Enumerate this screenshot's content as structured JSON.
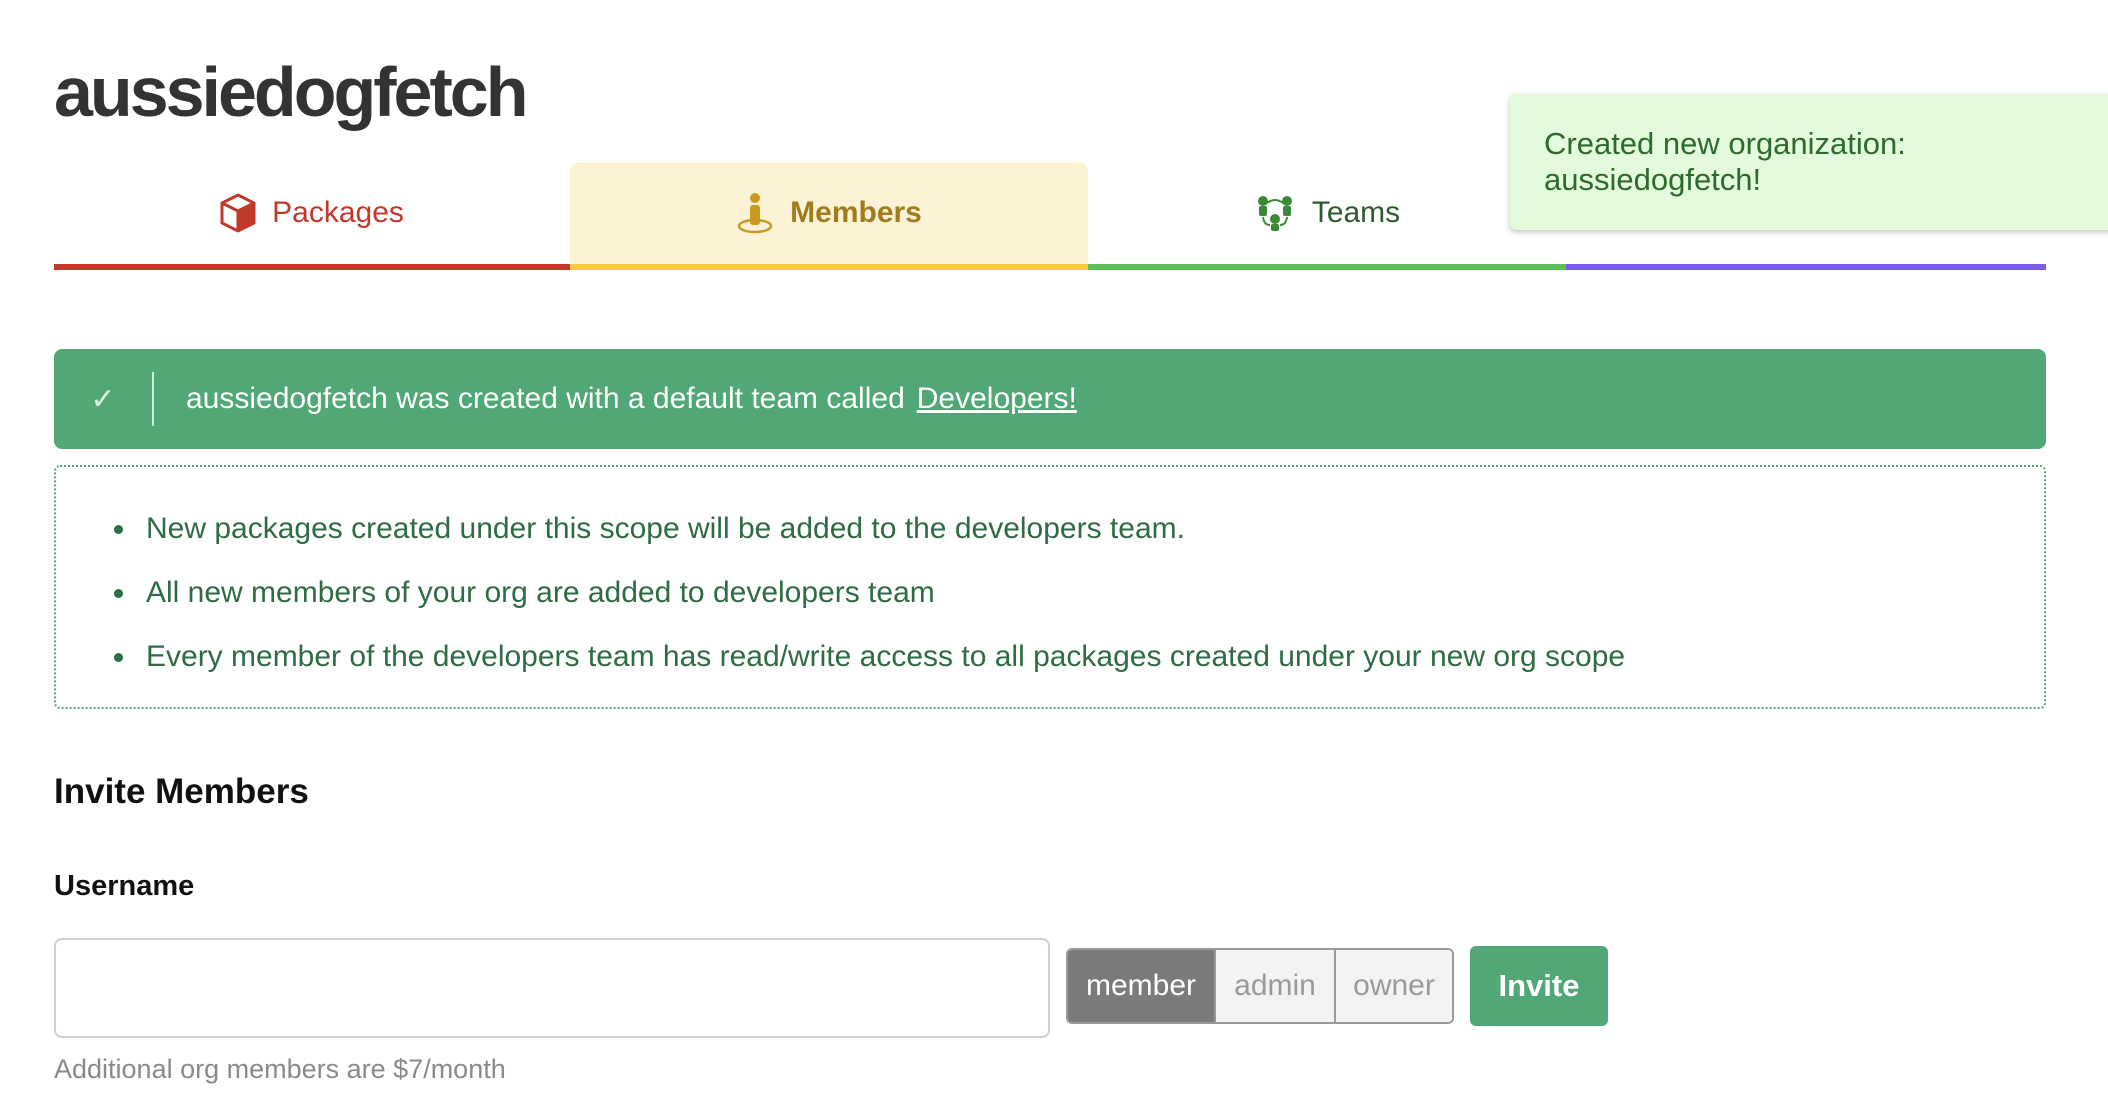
{
  "org": {
    "name": "aussiedogfetch"
  },
  "tabs": [
    {
      "label": "Packages",
      "icon": "cube-icon",
      "color": "#c0392b"
    },
    {
      "label": "Members",
      "icon": "person-icon",
      "color": "#f7c948",
      "active": true
    },
    {
      "label": "Teams",
      "icon": "people-group-icon",
      "color": "#5cbf5c"
    },
    {
      "label": "",
      "icon": "circle-icon",
      "color": "#7b5ce8"
    }
  ],
  "toast": {
    "message": "Created new organization: aussiedogfetch!"
  },
  "banner": {
    "check": "✓",
    "message": "aussiedogfetch was created with a default team called",
    "link": "Developers!"
  },
  "info": {
    "items": [
      "New packages created under this scope will be added to the developers team.",
      "All new members of your org are added to developers team",
      "Every member of the developers team has read/write access to all packages created under your new org scope"
    ]
  },
  "invite": {
    "title": "Invite Members",
    "username_label": "Username",
    "username_value": "",
    "roles": [
      "member",
      "admin",
      "owner"
    ],
    "selected_role": "member",
    "button": "Invite",
    "hint": "Additional org members are $7/month"
  }
}
